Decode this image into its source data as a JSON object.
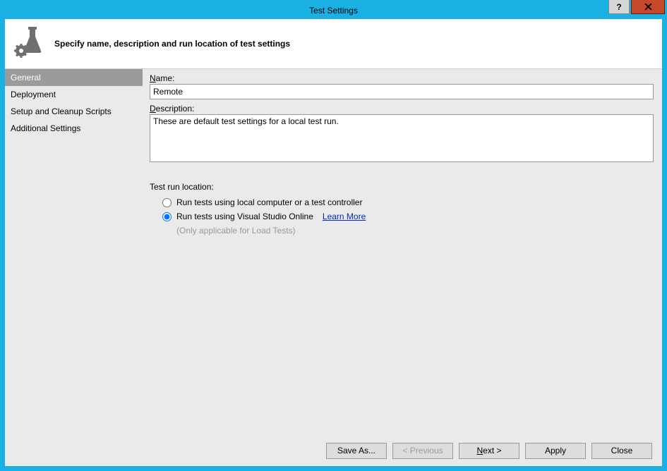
{
  "window": {
    "title": "Test Settings"
  },
  "header": {
    "subtitle": "Specify name, description and run location of test settings"
  },
  "sidebar": {
    "items": [
      {
        "label": "General"
      },
      {
        "label": "Deployment"
      },
      {
        "label": "Setup and Cleanup Scripts"
      },
      {
        "label": "Additional Settings"
      }
    ],
    "selected_index": 0
  },
  "form": {
    "name_label_pre": "N",
    "name_label_post": "ame:",
    "name_value": "Remote",
    "desc_label_pre": "D",
    "desc_label_post": "escription:",
    "desc_value": "These are default test settings for a local test run.",
    "run_loc_label": "Test run location:",
    "radio_local": "Run tests using local computer or a test controller",
    "radio_vso": "Run tests using Visual Studio Online",
    "learn_more": "Learn More",
    "vso_note": "(Only applicable for Load Tests)"
  },
  "buttons": {
    "save_as": "Save As...",
    "prev_pre": "< P",
    "prev_post": "revious",
    "next_pre": "N",
    "next_post": "ext >",
    "apply": "Apply",
    "close": "Close"
  }
}
